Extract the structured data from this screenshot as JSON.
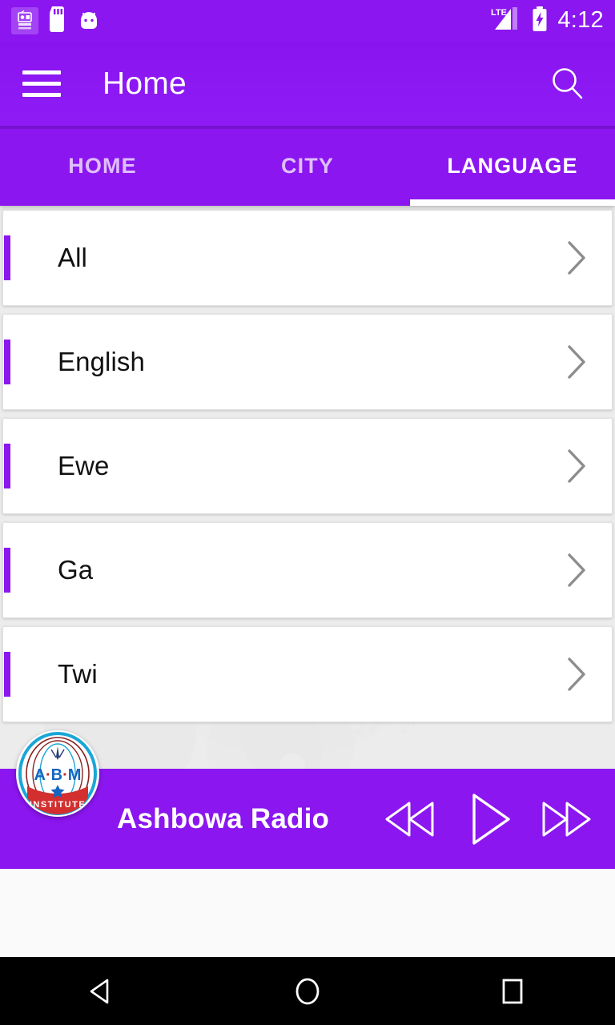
{
  "statusbar": {
    "time": "4:12",
    "icons": [
      "radio-app-notification-icon",
      "sd-card-icon",
      "android-head-icon"
    ],
    "network_label": "LTE",
    "battery": "charging"
  },
  "appbar": {
    "menu_icon": "hamburger-menu-icon",
    "title": "Home",
    "search_icon": "search-icon"
  },
  "tabs": [
    {
      "label": "HOME",
      "active": false
    },
    {
      "label": "CITY",
      "active": false
    },
    {
      "label": "LANGUAGE",
      "active": true
    }
  ],
  "list": {
    "items": [
      {
        "label": "All"
      },
      {
        "label": "English"
      },
      {
        "label": "Ewe"
      },
      {
        "label": "Ga"
      },
      {
        "label": "Twi"
      }
    ],
    "chevron_icon": "chevron-right-icon"
  },
  "player": {
    "station": "Ashbowa Radio",
    "logo": {
      "name": "abm-institute-logo",
      "letters": "A·B·M",
      "banner": "INSTITUTE"
    },
    "controls": [
      {
        "name": "rewind-button",
        "icon": "rewind-icon"
      },
      {
        "name": "play-button",
        "icon": "play-icon"
      },
      {
        "name": "fast-forward-button",
        "icon": "fast-forward-icon"
      }
    ]
  },
  "navbar": {
    "back": "back-nav-button",
    "home": "home-nav-button",
    "recents": "recents-nav-button"
  },
  "colors": {
    "primary": "#8B16F0",
    "accent": "#8B16F0",
    "content_bg": "#ececec",
    "card_bg": "#ffffff",
    "statusbar_text": "#ffffff"
  }
}
